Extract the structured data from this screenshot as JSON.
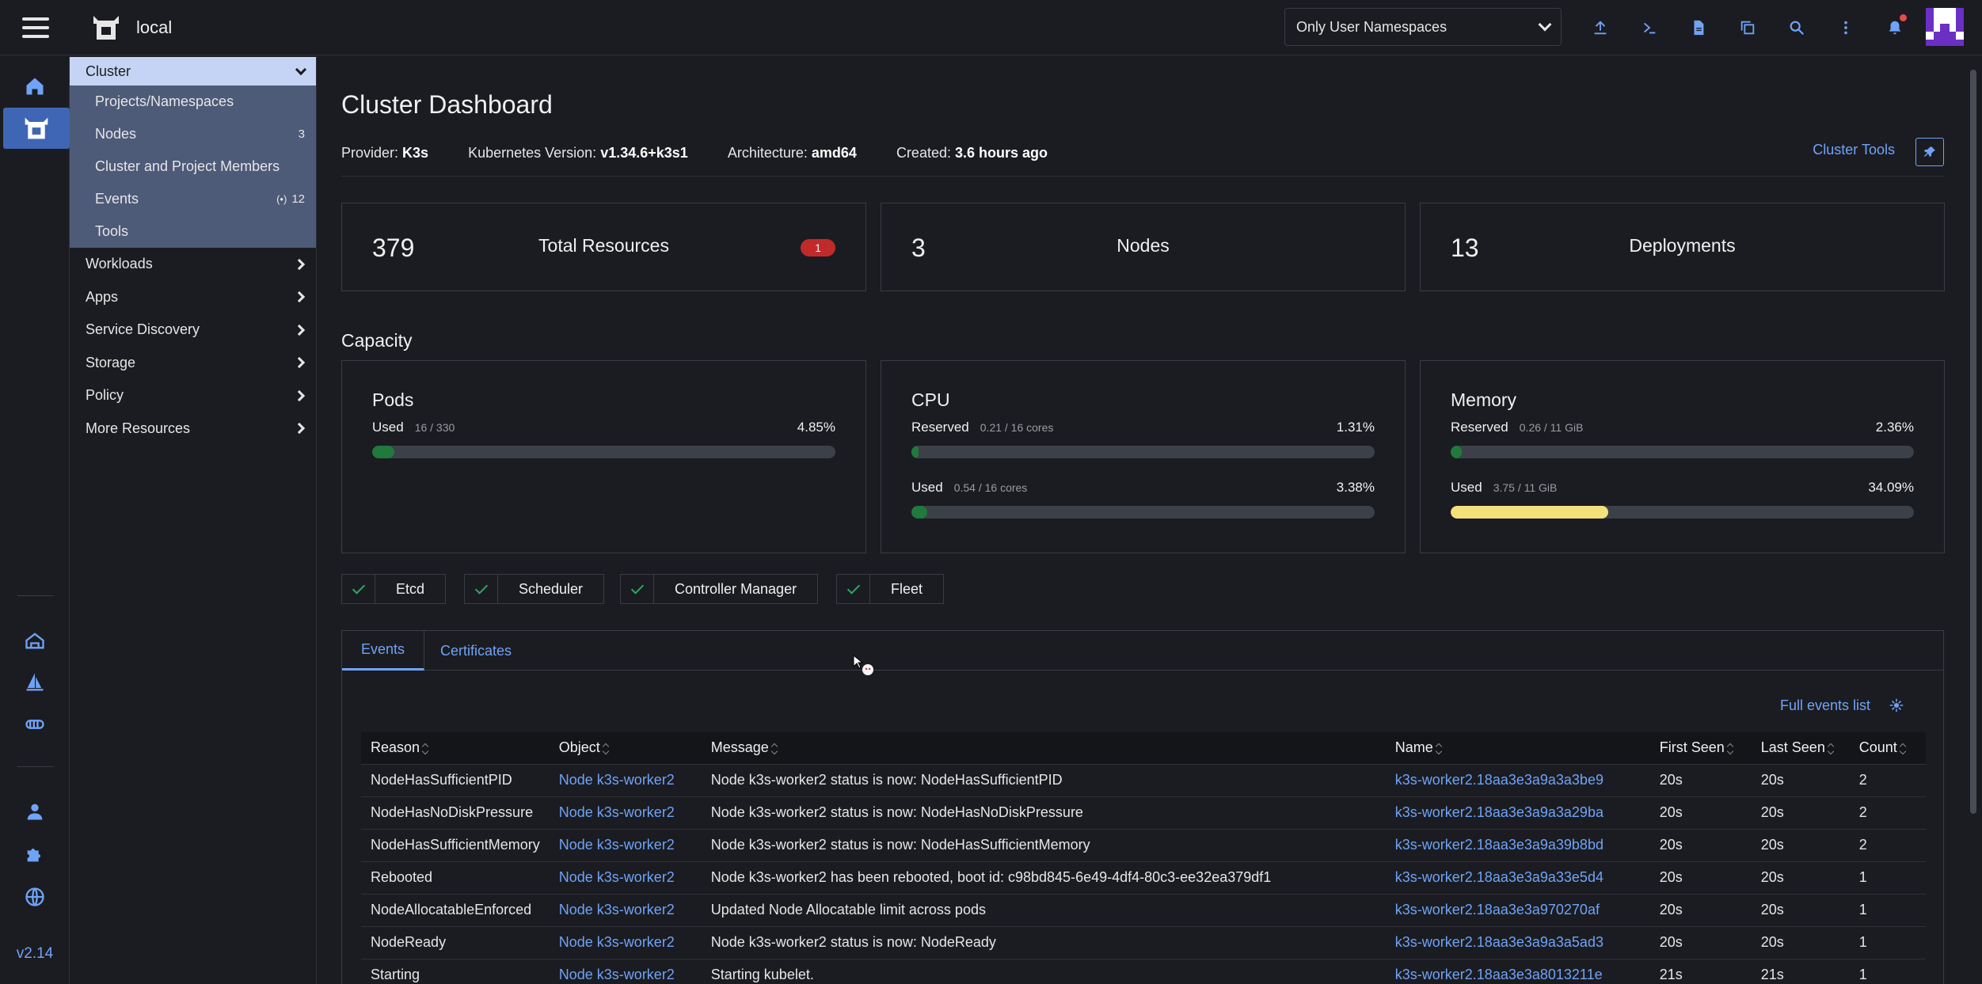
{
  "header": {
    "cluster_name": "local",
    "namespace_filter": "Only User Namespaces",
    "icons": [
      "import-yaml-icon",
      "kubectl-shell-icon",
      "kubeconfig-icon",
      "copy-kubeconfig-icon",
      "search-icon",
      "more-icon",
      "notifications-icon"
    ]
  },
  "rail": {
    "version": "v2.14"
  },
  "sidebar": {
    "cluster_group": "Cluster",
    "cluster_items": [
      {
        "label": "Projects/Namespaces",
        "count": ""
      },
      {
        "label": "Nodes",
        "count": "3"
      },
      {
        "label": "Cluster and Project Members",
        "count": ""
      },
      {
        "label": "Events",
        "count": "12"
      },
      {
        "label": "Tools",
        "count": ""
      }
    ],
    "groups": [
      "Workloads",
      "Apps",
      "Service Discovery",
      "Storage",
      "Policy",
      "More Resources"
    ]
  },
  "main": {
    "title": "Cluster Dashboard",
    "meta": {
      "provider_label": "Provider:",
      "provider": "K3s",
      "k8s_label": "Kubernetes Version:",
      "k8s": "v1.34.6+k3s1",
      "arch_label": "Architecture:",
      "arch": "amd64",
      "created_label": "Created:",
      "created": "3.6 hours ago"
    },
    "cluster_tools": "Cluster Tools",
    "stats": [
      {
        "value": "379",
        "label": "Total Resources",
        "badge": "1"
      },
      {
        "value": "3",
        "label": "Nodes"
      },
      {
        "value": "13",
        "label": "Deployments"
      }
    ],
    "capacity_title": "Capacity",
    "capacity": {
      "pods": {
        "title": "Pods",
        "used_label": "Used",
        "used_sub": "16 / 330",
        "used_pct": "4.85%",
        "used_fraction": 0.0485
      },
      "cpu": {
        "title": "CPU",
        "reserved_label": "Reserved",
        "reserved_sub": "0.21 / 16 cores",
        "reserved_pct": "1.31%",
        "reserved_fraction": 0.0131,
        "used_label": "Used",
        "used_sub": "0.54 / 16 cores",
        "used_pct": "3.38%",
        "used_fraction": 0.0338
      },
      "memory": {
        "title": "Memory",
        "reserved_label": "Reserved",
        "reserved_sub": "0.26 / 11 GiB",
        "reserved_pct": "2.36%",
        "reserved_fraction": 0.0236,
        "used_label": "Used",
        "used_sub": "3.75 / 11 GiB",
        "used_pct": "34.09%",
        "used_fraction": 0.3409
      }
    },
    "components": [
      "Etcd",
      "Scheduler",
      "Controller Manager",
      "Fleet"
    ],
    "tabs": [
      "Events",
      "Certificates"
    ],
    "full_events_link": "Full events list",
    "events_table": {
      "columns": [
        "Reason",
        "Object",
        "Message",
        "Name",
        "First Seen",
        "Last Seen",
        "Count"
      ],
      "rows": [
        [
          "NodeHasSufficientPID",
          "Node k3s-worker2",
          "Node k3s-worker2 status is now: NodeHasSufficientPID",
          "k3s-worker2.18aa3e3a9a3a3be9",
          "20s",
          "20s",
          "2"
        ],
        [
          "NodeHasNoDiskPressure",
          "Node k3s-worker2",
          "Node k3s-worker2 status is now: NodeHasNoDiskPressure",
          "k3s-worker2.18aa3e3a9a3a29ba",
          "20s",
          "20s",
          "2"
        ],
        [
          "NodeHasSufficientMemory",
          "Node k3s-worker2",
          "Node k3s-worker2 status is now: NodeHasSufficientMemory",
          "k3s-worker2.18aa3e3a9a39b8bd",
          "20s",
          "20s",
          "2"
        ],
        [
          "Rebooted",
          "Node k3s-worker2",
          "Node k3s-worker2 has been rebooted, boot id: c98bd845-6e49-4df4-80c3-ee32ea379df1",
          "k3s-worker2.18aa3e3a9a33e5d4",
          "20s",
          "20s",
          "1"
        ],
        [
          "NodeAllocatableEnforced",
          "Node k3s-worker2",
          "Updated Node Allocatable limit across pods",
          "k3s-worker2.18aa3e3a970270af",
          "20s",
          "20s",
          "1"
        ],
        [
          "NodeReady",
          "Node k3s-worker2",
          "Node k3s-worker2 status is now: NodeReady",
          "k3s-worker2.18aa3e3a9a3a5ad3",
          "20s",
          "20s",
          "1"
        ],
        [
          "Starting",
          "Node k3s-worker2",
          "Starting kubelet.",
          "k3s-worker2.18aa3e3a8013211e",
          "21s",
          "21s",
          "1"
        ]
      ]
    }
  },
  "colors": {
    "accent": "#6fa3f7",
    "green_fill": "#1f7a3c",
    "yellow_fill": "#f3e27a",
    "danger": "#c02a2a"
  }
}
